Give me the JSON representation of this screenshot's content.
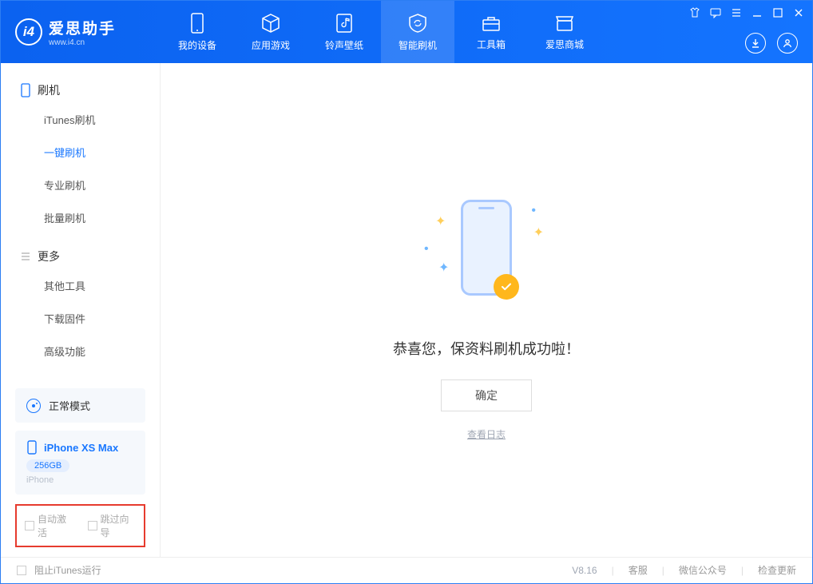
{
  "app": {
    "title": "爱思助手",
    "subtitle": "www.i4.cn"
  },
  "nav": {
    "items": [
      {
        "label": "我的设备"
      },
      {
        "label": "应用游戏"
      },
      {
        "label": "铃声壁纸"
      },
      {
        "label": "智能刷机"
      },
      {
        "label": "工具箱"
      },
      {
        "label": "爱思商城"
      }
    ]
  },
  "sidebar": {
    "sections": [
      {
        "title": "刷机",
        "items": [
          "iTunes刷机",
          "一键刷机",
          "专业刷机",
          "批量刷机"
        ]
      },
      {
        "title": "更多",
        "items": [
          "其他工具",
          "下载固件",
          "高级功能"
        ]
      }
    ],
    "mode_label": "正常模式",
    "device": {
      "name": "iPhone XS Max",
      "capacity": "256GB",
      "type": "iPhone"
    },
    "opts": {
      "auto_activate": "自动激活",
      "skip_guide": "跳过向导"
    }
  },
  "main": {
    "success_msg": "恭喜您，保资料刷机成功啦！",
    "ok_btn": "确定",
    "view_log": "查看日志"
  },
  "footer": {
    "stop_itunes": "阻止iTunes运行",
    "version": "V8.16",
    "links": [
      "客服",
      "微信公众号",
      "检查更新"
    ]
  }
}
